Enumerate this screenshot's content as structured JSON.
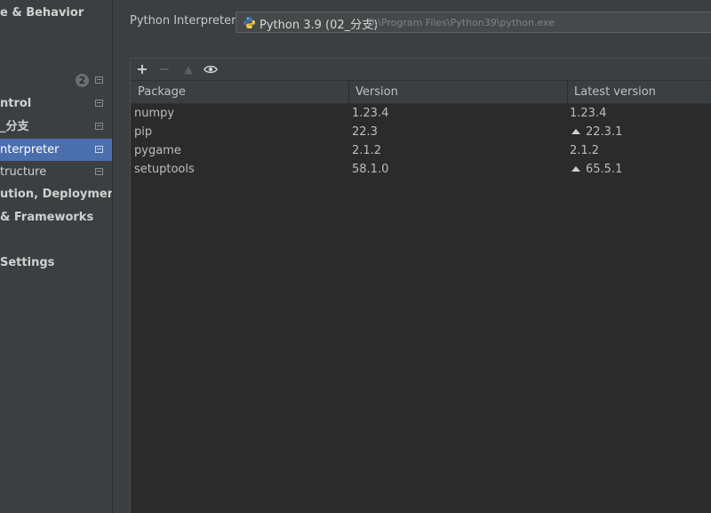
{
  "sidebar": {
    "items": [
      {
        "label": "e & Behavior",
        "style": "bold"
      },
      {
        "label": "",
        "style": "spacer"
      },
      {
        "label": "",
        "style": "badge-row"
      },
      {
        "label": "ntrol",
        "style": "bold"
      },
      {
        "label": "_分支",
        "style": "bold"
      },
      {
        "label": "nterpreter",
        "style": "selected"
      },
      {
        "label": "tructure",
        "style": "sub"
      },
      {
        "label": "ution, Deployment",
        "style": "bold"
      },
      {
        "label": "& Frameworks",
        "style": "bold"
      },
      {
        "label": "Settings",
        "style": "bold"
      }
    ],
    "badge_count": "2"
  },
  "interpreter": {
    "label": "Python Interpreter:",
    "name": "Python 3.9 (02_分支)",
    "path": "D:\\Program Files\\Python39\\python.exe"
  },
  "toolbar": {
    "add_icon": "plus-icon",
    "remove_icon": "minus-icon",
    "upgrade_icon": "upgrade-icon",
    "show_icon": "eye-icon"
  },
  "table": {
    "headers": [
      "Package",
      "Version",
      "Latest version"
    ],
    "rows": [
      {
        "package": "numpy",
        "version": "1.23.4",
        "latest": "1.23.4",
        "upgrade": false
      },
      {
        "package": "pip",
        "version": "22.3",
        "latest": "22.3.1",
        "upgrade": true
      },
      {
        "package": "pygame",
        "version": "2.1.2",
        "latest": "2.1.2",
        "upgrade": false
      },
      {
        "package": "setuptools",
        "version": "58.1.0",
        "latest": "65.5.1",
        "upgrade": true
      }
    ]
  },
  "colors": {
    "selection": "#4b6eaf",
    "background": "#3c3f41",
    "table_bg": "#2b2b2b"
  }
}
